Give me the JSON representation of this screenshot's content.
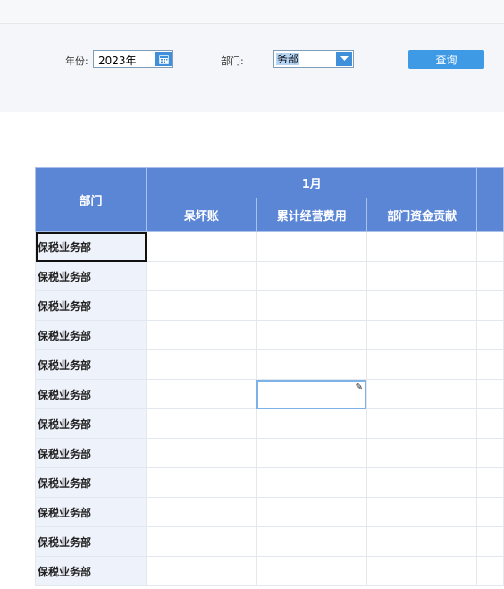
{
  "filters": {
    "year_label": "年份:",
    "year_value": "2023年",
    "dept_label": "部门:",
    "dept_value": "务部",
    "query_label": "查询"
  },
  "table": {
    "dept_header": "部门",
    "month_header": "1月",
    "columns": [
      "呆坏账",
      "累计经营费用",
      "部门资金贡献"
    ],
    "rows": [
      "保税业务部",
      "保税业务部",
      "保税业务部",
      "保税业务部",
      "保税业务部",
      "保税业务部",
      "保税业务部",
      "保税业务部",
      "保税业务部",
      "保税业务部",
      "保税业务部",
      "保税业务部"
    ]
  },
  "icons": {
    "year_picker": "calendar-icon",
    "dept_dropdown": "chevron-down-icon",
    "edit_cell": "pencil-icon"
  },
  "colors": {
    "header_bg": "#5b86d6",
    "button_bg": "#3f9ae5",
    "dept_cell_bg": "#eef2fa"
  }
}
